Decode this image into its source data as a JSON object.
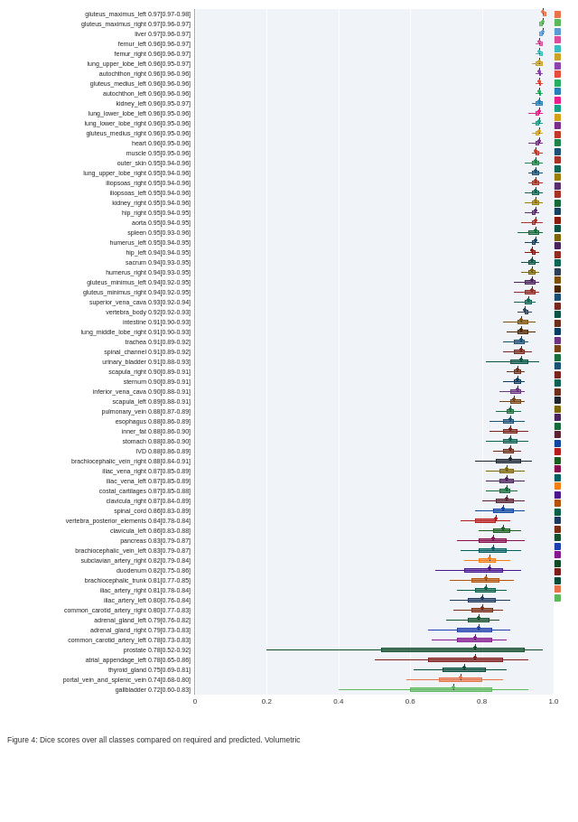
{
  "chart": {
    "title": "Dice scores over all classes compared on required and predicted. Volumetric",
    "caption": "Figure 4: Dice scores over all classes compared on required and predicted. Volumetric",
    "x_axis_labels": [
      "0",
      "0.2",
      "0.4",
      "0.6",
      "0.8",
      "1"
    ],
    "x_axis_values": [
      0,
      0.2,
      0.4,
      0.6,
      0.8,
      1.0
    ],
    "rows": [
      {
        "label": "gluteus_maximus_left 0.97[0.97-0.98]",
        "color": "#e06030",
        "q1": 0.97,
        "median": 0.97,
        "q3": 0.98,
        "min": 0.97,
        "max": 0.98,
        "dot": 0.97
      },
      {
        "label": "gluteus_maximus_right 0.97[0.96-0.97]",
        "color": "#50c050",
        "q1": 0.96,
        "median": 0.97,
        "q3": 0.97,
        "min": 0.96,
        "max": 0.97,
        "dot": 0.97
      },
      {
        "label": "liver 0.97[0.96-0.97]",
        "color": "#5080e0",
        "q1": 0.96,
        "median": 0.97,
        "q3": 0.97,
        "min": 0.96,
        "max": 0.97,
        "dot": 0.97
      },
      {
        "label": "femur_left 0.96[0.96-0.97]",
        "color": "#e050a0",
        "q1": 0.96,
        "median": 0.96,
        "q3": 0.97,
        "min": 0.95,
        "max": 0.97,
        "dot": 0.96
      },
      {
        "label": "femur_right 0.96[0.96-0.97]",
        "color": "#30c0c0",
        "q1": 0.96,
        "median": 0.96,
        "q3": 0.97,
        "min": 0.95,
        "max": 0.97,
        "dot": 0.96
      },
      {
        "label": "lung_upper_lobe_left 0.96[0.95-0.97]",
        "color": "#c0a030",
        "q1": 0.95,
        "median": 0.96,
        "q3": 0.97,
        "min": 0.94,
        "max": 0.97,
        "dot": 0.96
      },
      {
        "label": "autochthon_right 0.96[0.96-0.96]",
        "color": "#9050d0",
        "q1": 0.96,
        "median": 0.96,
        "q3": 0.96,
        "min": 0.95,
        "max": 0.97,
        "dot": 0.96
      },
      {
        "label": "gluteus_medius_left 0.96[0.96-0.96]",
        "color": "#d04040",
        "q1": 0.96,
        "median": 0.96,
        "q3": 0.96,
        "min": 0.95,
        "max": 0.97,
        "dot": 0.96
      },
      {
        "label": "autochthon_left 0.96[0.96-0.96]",
        "color": "#40a840",
        "q1": 0.96,
        "median": 0.96,
        "q3": 0.96,
        "min": 0.95,
        "max": 0.97,
        "dot": 0.96
      },
      {
        "label": "kidney_left 0.96[0.95-0.97]",
        "color": "#4060c0",
        "q1": 0.95,
        "median": 0.96,
        "q3": 0.97,
        "min": 0.94,
        "max": 0.97,
        "dot": 0.96
      },
      {
        "label": "lung_lower_lobe_left 0.96[0.95-0.96]",
        "color": "#c050a0",
        "q1": 0.95,
        "median": 0.96,
        "q3": 0.96,
        "min": 0.93,
        "max": 0.97,
        "dot": 0.96
      },
      {
        "label": "lung_lower_lobe_right 0.96[0.95-0.96]",
        "color": "#20b0b0",
        "q1": 0.95,
        "median": 0.96,
        "q3": 0.96,
        "min": 0.94,
        "max": 0.97,
        "dot": 0.96
      },
      {
        "label": "gluteus_medius_right 0.96[0.95-0.96]",
        "color": "#b09020",
        "q1": 0.95,
        "median": 0.96,
        "q3": 0.96,
        "min": 0.94,
        "max": 0.97,
        "dot": 0.96
      },
      {
        "label": "heart 0.96[0.95-0.96]",
        "color": "#8040c0",
        "q1": 0.95,
        "median": 0.96,
        "q3": 0.96,
        "min": 0.93,
        "max": 0.97,
        "dot": 0.96
      },
      {
        "label": "muscle 0.95[0.95-0.96]",
        "color": "#c03030",
        "q1": 0.95,
        "median": 0.95,
        "q3": 0.96,
        "min": 0.94,
        "max": 0.97,
        "dot": 0.95
      },
      {
        "label": "outer_skin 0.95[0.94-0.96]",
        "color": "#309830",
        "q1": 0.94,
        "median": 0.95,
        "q3": 0.96,
        "min": 0.92,
        "max": 0.97,
        "dot": 0.95
      },
      {
        "label": "lung_upper_lobe_right 0.95[0.94-0.96]",
        "color": "#3050b0",
        "q1": 0.94,
        "median": 0.95,
        "q3": 0.96,
        "min": 0.93,
        "max": 0.97,
        "dot": 0.95
      },
      {
        "label": "iliopsoas_right 0.95[0.94-0.96]",
        "color": "#b04090",
        "q1": 0.94,
        "median": 0.95,
        "q3": 0.96,
        "min": 0.93,
        "max": 0.97,
        "dot": 0.95
      },
      {
        "label": "iliopsoas_left 0.95[0.94-0.96]",
        "color": "#10a0a0",
        "q1": 0.94,
        "median": 0.95,
        "q3": 0.96,
        "min": 0.92,
        "max": 0.97,
        "dot": 0.95
      },
      {
        "label": "kidney_right 0.95[0.94-0.96]",
        "color": "#a08010",
        "q1": 0.94,
        "median": 0.95,
        "q3": 0.96,
        "min": 0.92,
        "max": 0.97,
        "dot": 0.95
      },
      {
        "label": "hip_right 0.95[0.94-0.95]",
        "color": "#7030b0",
        "q1": 0.94,
        "median": 0.95,
        "q3": 0.95,
        "min": 0.92,
        "max": 0.96,
        "dot": 0.95
      },
      {
        "label": "aorta 0.95[0.94-0.95]",
        "color": "#b02020",
        "q1": 0.94,
        "median": 0.95,
        "q3": 0.95,
        "min": 0.91,
        "max": 0.97,
        "dot": 0.95
      },
      {
        "label": "spleen 0.95[0.93-0.96]",
        "color": "#208820",
        "q1": 0.93,
        "median": 0.95,
        "q3": 0.96,
        "min": 0.9,
        "max": 0.97,
        "dot": 0.95
      },
      {
        "label": "humerus_left 0.95[0.94-0.95]",
        "color": "#2040a0",
        "q1": 0.94,
        "median": 0.95,
        "q3": 0.95,
        "min": 0.92,
        "max": 0.96,
        "dot": 0.95
      },
      {
        "label": "hip_left 0.94[0.94-0.95]",
        "color": "#a03080",
        "q1": 0.94,
        "median": 0.94,
        "q3": 0.95,
        "min": 0.92,
        "max": 0.96,
        "dot": 0.94
      },
      {
        "label": "sacrum 0.94[0.93-0.95]",
        "color": "#009090",
        "q1": 0.93,
        "median": 0.94,
        "q3": 0.95,
        "min": 0.91,
        "max": 0.96,
        "dot": 0.94
      },
      {
        "label": "humerus_right 0.94[0.93-0.95]",
        "color": "#907000",
        "q1": 0.93,
        "median": 0.94,
        "q3": 0.95,
        "min": 0.91,
        "max": 0.96,
        "dot": 0.94
      },
      {
        "label": "gluteus_minimus_left 0.94[0.92-0.95]",
        "color": "#6020a0",
        "q1": 0.92,
        "median": 0.94,
        "q3": 0.95,
        "min": 0.89,
        "max": 0.96,
        "dot": 0.94
      },
      {
        "label": "gluteus_minimus_right 0.94[0.92-0.95]",
        "color": "#a01010",
        "q1": 0.92,
        "median": 0.94,
        "q3": 0.95,
        "min": 0.89,
        "max": 0.96,
        "dot": 0.94
      },
      {
        "label": "superior_vena_cava 0.93[0.92-0.94]",
        "color": "#107810",
        "q1": 0.92,
        "median": 0.93,
        "q3": 0.94,
        "min": 0.89,
        "max": 0.95,
        "dot": 0.93
      },
      {
        "label": "vertebra_body 0.92[0.92-0.93]",
        "color": "#103090",
        "q1": 0.92,
        "median": 0.92,
        "q3": 0.93,
        "min": 0.9,
        "max": 0.94,
        "dot": 0.92
      },
      {
        "label": "intestine 0.91[0.90-0.93]",
        "color": "#902070",
        "q1": 0.9,
        "median": 0.91,
        "q3": 0.93,
        "min": 0.86,
        "max": 0.95,
        "dot": 0.91
      },
      {
        "label": "lung_middle_lobe_right 0.91[0.90-0.93]",
        "color": "#007080",
        "q1": 0.9,
        "median": 0.91,
        "q3": 0.93,
        "min": 0.87,
        "max": 0.95,
        "dot": 0.91
      },
      {
        "label": "trachea 0.91[0.89-0.92]",
        "color": "#806000",
        "q1": 0.89,
        "median": 0.91,
        "q3": 0.92,
        "min": 0.86,
        "max": 0.93,
        "dot": 0.91
      },
      {
        "label": "spinal_channel 0.91[0.89-0.92]",
        "color": "#501090",
        "q1": 0.89,
        "median": 0.91,
        "q3": 0.92,
        "min": 0.86,
        "max": 0.94,
        "dot": 0.91
      },
      {
        "label": "urinary_bladder 0.91[0.88-0.93]",
        "color": "#900000",
        "q1": 0.88,
        "median": 0.91,
        "q3": 0.93,
        "min": 0.81,
        "max": 0.96,
        "dot": 0.91
      },
      {
        "label": "scapula_right 0.90[0.89-0.91]",
        "color": "#006800",
        "q1": 0.89,
        "median": 0.9,
        "q3": 0.91,
        "min": 0.87,
        "max": 0.92,
        "dot": 0.9
      },
      {
        "label": "sternum 0.90[0.89-0.91]",
        "color": "#102080",
        "q1": 0.89,
        "median": 0.9,
        "q3": 0.91,
        "min": 0.86,
        "max": 0.92,
        "dot": 0.9
      },
      {
        "label": "inferior_vena_cava 0.90[0.88-0.91]",
        "color": "#801060",
        "q1": 0.88,
        "median": 0.9,
        "q3": 0.91,
        "min": 0.85,
        "max": 0.92,
        "dot": 0.9
      },
      {
        "label": "scapula_left 0.89[0.88-0.91]",
        "color": "#006070",
        "q1": 0.88,
        "median": 0.89,
        "q3": 0.91,
        "min": 0.85,
        "max": 0.92,
        "dot": 0.89
      },
      {
        "label": "pulmonary_vein 0.88[0.87-0.89]",
        "color": "#705000",
        "q1": 0.87,
        "median": 0.88,
        "q3": 0.89,
        "min": 0.84,
        "max": 0.91,
        "dot": 0.88
      },
      {
        "label": "esophagus 0.88[0.86-0.89]",
        "color": "#400880",
        "q1": 0.86,
        "median": 0.88,
        "q3": 0.89,
        "min": 0.82,
        "max": 0.92,
        "dot": 0.88
      },
      {
        "label": "inner_fat 0.88[0.86-0.90]",
        "color": "#800000",
        "q1": 0.86,
        "median": 0.88,
        "q3": 0.9,
        "min": 0.82,
        "max": 0.93,
        "dot": 0.88
      },
      {
        "label": "stomach 0.88[0.86-0.90]",
        "color": "#005800",
        "q1": 0.86,
        "median": 0.88,
        "q3": 0.9,
        "min": 0.81,
        "max": 0.93,
        "dot": 0.88
      },
      {
        "label": "IVD 0.88[0.86-0.89]",
        "color": "#0c1870",
        "q1": 0.86,
        "median": 0.88,
        "q3": 0.89,
        "min": 0.83,
        "max": 0.91,
        "dot": 0.88
      },
      {
        "label": "brachiocephalic_vein_right 0.88[0.84-0.91]",
        "color": "#700850",
        "q1": 0.84,
        "median": 0.88,
        "q3": 0.91,
        "min": 0.78,
        "max": 0.94,
        "dot": 0.88
      },
      {
        "label": "iliac_vena_right 0.87[0.85-0.89]",
        "color": "#005060",
        "q1": 0.85,
        "median": 0.87,
        "q3": 0.89,
        "min": 0.81,
        "max": 0.92,
        "dot": 0.87
      },
      {
        "label": "iliac_vena_left 0.87[0.85-0.89]",
        "color": "#604000",
        "q1": 0.85,
        "median": 0.87,
        "q3": 0.89,
        "min": 0.81,
        "max": 0.92,
        "dot": 0.87
      },
      {
        "label": "costal_cartilages 0.87[0.85-0.88]",
        "color": "#300870",
        "q1": 0.85,
        "median": 0.87,
        "q3": 0.88,
        "min": 0.81,
        "max": 0.9,
        "dot": 0.87
      },
      {
        "label": "clavicula_right 0.87[0.84-0.89]",
        "color": "#700000",
        "q1": 0.84,
        "median": 0.87,
        "q3": 0.89,
        "min": 0.8,
        "max": 0.92,
        "dot": 0.87
      },
      {
        "label": "spinal_cord 0.86[0.83-0.89]",
        "color": "#004800",
        "q1": 0.83,
        "median": 0.86,
        "q3": 0.89,
        "min": 0.78,
        "max": 0.92,
        "dot": 0.86
      },
      {
        "label": "vertebra_posterior_elements 0.84[0.78-0.84]",
        "color": "#001060",
        "q1": 0.78,
        "median": 0.84,
        "q3": 0.84,
        "min": 0.74,
        "max": 0.88,
        "dot": 0.84
      },
      {
        "label": "clavicula_left 0.86[0.83-0.88]",
        "color": "#600040",
        "q1": 0.83,
        "median": 0.86,
        "q3": 0.88,
        "min": 0.79,
        "max": 0.91,
        "dot": 0.86
      },
      {
        "label": "pancreas 0.83[0.79-0.87]",
        "color": "#004050",
        "q1": 0.79,
        "median": 0.83,
        "q3": 0.87,
        "min": 0.73,
        "max": 0.92,
        "dot": 0.83
      },
      {
        "label": "brachiocephalic_vein_left 0.83[0.79-0.87]",
        "color": "#503000",
        "q1": 0.79,
        "median": 0.83,
        "q3": 0.87,
        "min": 0.74,
        "max": 0.91,
        "dot": 0.83
      },
      {
        "label": "subclavian_artery_right 0.82[0.79-0.84]",
        "color": "#200860",
        "q1": 0.79,
        "median": 0.82,
        "q3": 0.84,
        "min": 0.75,
        "max": 0.88,
        "dot": 0.82
      },
      {
        "label": "duodenum 0.82[0.75-0.86]",
        "color": "#600000",
        "q1": 0.75,
        "median": 0.82,
        "q3": 0.86,
        "min": 0.67,
        "max": 0.91,
        "dot": 0.82
      },
      {
        "label": "brachiocephalic_trunk 0.81[0.77-0.85]",
        "color": "#003800",
        "q1": 0.77,
        "median": 0.81,
        "q3": 0.85,
        "min": 0.71,
        "max": 0.89,
        "dot": 0.81
      },
      {
        "label": "iliac_artery_right 0.81[0.78-0.84]",
        "color": "#000850",
        "q1": 0.78,
        "median": 0.81,
        "q3": 0.84,
        "min": 0.73,
        "max": 0.87,
        "dot": 0.81
      },
      {
        "label": "iliac_artery_left 0.80[0.76-0.84]",
        "color": "#500030",
        "q1": 0.76,
        "median": 0.8,
        "q3": 0.84,
        "min": 0.71,
        "max": 0.88,
        "dot": 0.8
      },
      {
        "label": "common_carotid_artery_right 0.80[0.77-0.83]",
        "color": "#003040",
        "q1": 0.77,
        "median": 0.8,
        "q3": 0.83,
        "min": 0.72,
        "max": 0.86,
        "dot": 0.8
      },
      {
        "label": "adrenal_gland_left 0.79[0.76-0.82]",
        "color": "#402000",
        "q1": 0.76,
        "median": 0.79,
        "q3": 0.82,
        "min": 0.7,
        "max": 0.85,
        "dot": 0.79
      },
      {
        "label": "adrenal_gland_right 0.79[0.73-0.83]",
        "color": "#100850",
        "q1": 0.73,
        "median": 0.79,
        "q3": 0.83,
        "min": 0.65,
        "max": 0.88,
        "dot": 0.79
      },
      {
        "label": "common_carotid_artery_left 0.78[0.73-0.83]",
        "color": "#500020",
        "q1": 0.73,
        "median": 0.78,
        "q3": 0.83,
        "min": 0.66,
        "max": 0.87,
        "dot": 0.78
      },
      {
        "label": "prostate 0.78[0.52-0.92]",
        "color": "#002830",
        "q1": 0.52,
        "median": 0.78,
        "q3": 0.92,
        "min": 0.2,
        "max": 0.97,
        "dot": 0.78
      },
      {
        "label": "atrial_appendage_left 0.78[0.65-0.86]",
        "color": "#301800",
        "q1": 0.65,
        "median": 0.78,
        "q3": 0.86,
        "min": 0.5,
        "max": 0.93,
        "dot": 0.78
      },
      {
        "label": "thyroid_gland 0.75[0.69-0.81]",
        "color": "#000840",
        "q1": 0.69,
        "median": 0.75,
        "q3": 0.81,
        "min": 0.61,
        "max": 0.87,
        "dot": 0.75
      },
      {
        "label": "portal_vein_and_splenic_vein 0.74[0.68-0.80]",
        "color": "#400010",
        "q1": 0.68,
        "median": 0.74,
        "q3": 0.8,
        "min": 0.59,
        "max": 0.86,
        "dot": 0.74
      },
      {
        "label": "gallbladder 0.72[0.60-0.83]",
        "color": "#002020",
        "q1": 0.6,
        "median": 0.72,
        "q3": 0.83,
        "min": 0.4,
        "max": 0.93,
        "dot": 0.72
      }
    ]
  }
}
